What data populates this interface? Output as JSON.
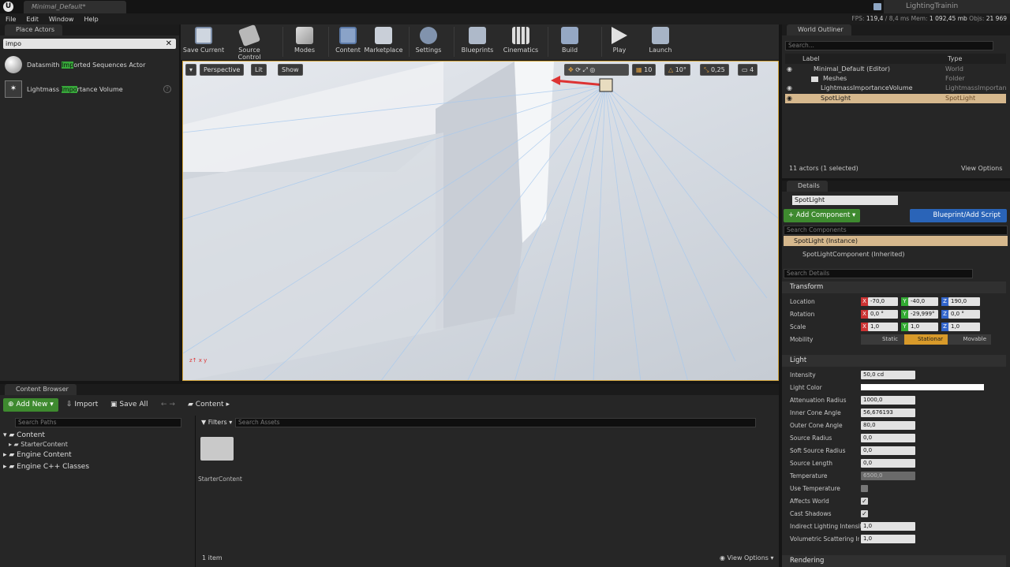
{
  "window": {
    "doc_tab": "Minimal_Default*",
    "project": "LightingTrainin"
  },
  "menu": [
    "File",
    "Edit",
    "Window",
    "Help"
  ],
  "stats": {
    "fps_label": "FPS:",
    "fps": "119,4",
    "ms": "/ 8,4 ms",
    "mem_label": "Mem:",
    "mem": "1 092,45 mb",
    "objs_label": "Objs:",
    "objs": "21 969"
  },
  "place_actors": {
    "tab": "Place Actors",
    "search_value": "impo",
    "items": [
      {
        "pre": "Datasmith ",
        "hl": "Imp",
        "post": "orted Sequences Actor"
      },
      {
        "pre": "Lightmass ",
        "hl": "Impo",
        "post": "rtance Volume"
      }
    ]
  },
  "toolbar": {
    "buttons": [
      "Save Current",
      "Source Control",
      "Modes",
      "Content",
      "Marketplace",
      "Settings",
      "Blueprints",
      "Cinematics",
      "Build",
      "Play",
      "Launch"
    ]
  },
  "viewport": {
    "perspective": "Perspective",
    "lit": "Lit",
    "show": "Show",
    "grid": "10",
    "angle": "10°",
    "scale": "0,25",
    "cam": "4"
  },
  "outliner": {
    "tab": "World Outliner",
    "search_placeholder": "Search...",
    "col_label": "Label",
    "col_type": "Type",
    "rows": [
      {
        "label": "Minimal_Default (Editor)",
        "type": "World"
      },
      {
        "label": "Meshes",
        "type": "Folder"
      },
      {
        "label": "LightmassImportanceVolume",
        "type": "LightmassImportance"
      },
      {
        "label": "SpotLight",
        "type": "SpotLight"
      }
    ],
    "footer": "11 actors (1 selected)",
    "view_options": "View Options"
  },
  "details": {
    "tab": "Details",
    "name": "SpotLight",
    "add_component": "Add Component",
    "blueprint": "Blueprint/Add Script",
    "search_components": "Search Components",
    "instance": "SpotLight (Instance)",
    "component": "SpotLightComponent (Inherited)",
    "search_details": "Search Details",
    "transform": {
      "title": "Transform",
      "location": "Location",
      "rotation": "Rotation",
      "scale": "Scale",
      "mobility": "Mobility",
      "loc": [
        "-70,0",
        "-40,0",
        "190,0"
      ],
      "rot": [
        "0,0 °",
        "-29,999°",
        "0,0 °"
      ],
      "scl": [
        "1,0",
        "1,0",
        "1,0"
      ],
      "mob": [
        "Static",
        "Stationar",
        "Movable"
      ]
    },
    "light": {
      "title": "Light",
      "props": [
        {
          "label": "Intensity",
          "value": "50,0 cd"
        },
        {
          "label": "Light Color",
          "value": ""
        },
        {
          "label": "Attenuation Radius",
          "value": "1000,0"
        },
        {
          "label": "Inner Cone Angle",
          "value": "56,676193"
        },
        {
          "label": "Outer Cone Angle",
          "value": "80,0"
        },
        {
          "label": "Source Radius",
          "value": "0,0"
        },
        {
          "label": "Soft Source Radius",
          "value": "0,0"
        },
        {
          "label": "Source Length",
          "value": "0,0"
        },
        {
          "label": "Temperature",
          "value": "6500,0"
        },
        {
          "label": "Use Temperature",
          "value": ""
        },
        {
          "label": "Affects World",
          "value": ""
        },
        {
          "label": "Cast Shadows",
          "value": ""
        },
        {
          "label": "Indirect Lighting Intensity",
          "value": "1,0"
        },
        {
          "label": "Volumetric Scattering Inte",
          "value": "1,0"
        }
      ]
    },
    "rendering": "Rendering"
  },
  "content_browser": {
    "tab": "Content Browser",
    "add_new": "Add New",
    "import": "Import",
    "save_all": "Save All",
    "path": "Content",
    "search_paths": "Search Paths",
    "filters": "Filters",
    "search_assets": "Search Assets",
    "tree": [
      "Content",
      "StarterContent",
      "Engine Content",
      "Engine C++ Classes"
    ],
    "asset": "StarterContent",
    "count": "1 item",
    "view_options": "View Options"
  },
  "colors": {
    "accent_green": "#3e8a2f",
    "accent_blue": "#2a64b8",
    "selection": "#d6b88d",
    "highlight": "#37a83a"
  }
}
